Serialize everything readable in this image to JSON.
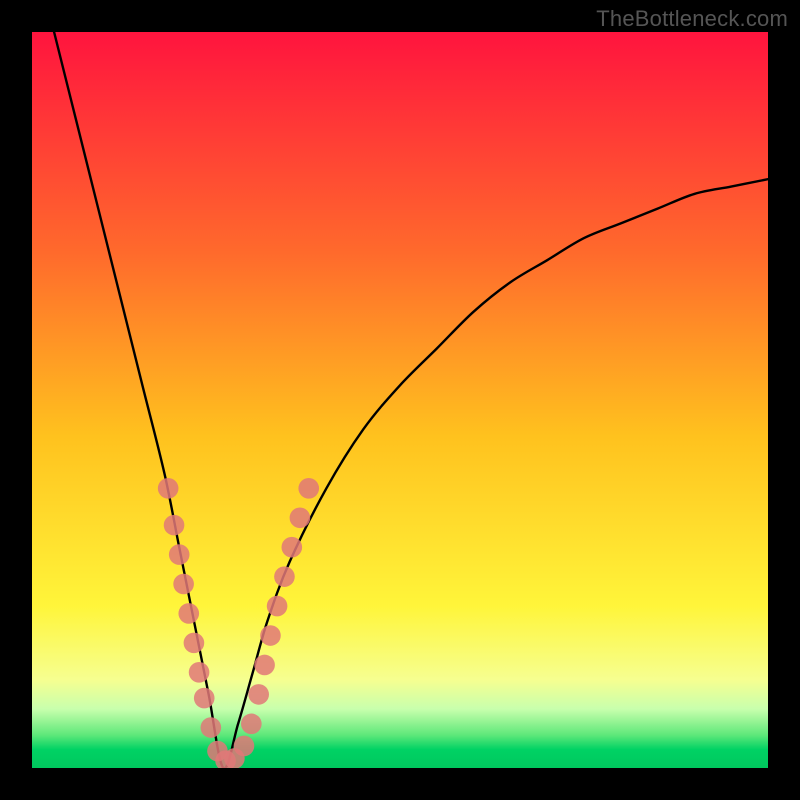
{
  "watermark": "TheBottleneck.com",
  "chart_data": {
    "type": "line",
    "title": "",
    "xlabel": "",
    "ylabel": "",
    "xlim": [
      0,
      100
    ],
    "ylim": [
      0,
      100
    ],
    "grid": false,
    "legend": false,
    "annotations": [],
    "series": [
      {
        "name": "bottleneck-curve",
        "description": "V-shaped curve; y≈100 at left, dips to ~0 near x≈26, rises to ~80 at right edge",
        "x": [
          3,
          6,
          9,
          12,
          15,
          18,
          20,
          22,
          24,
          26,
          28,
          30,
          32,
          35,
          40,
          45,
          50,
          55,
          60,
          65,
          70,
          75,
          80,
          85,
          90,
          95,
          100
        ],
        "values": [
          100,
          88,
          76,
          64,
          52,
          40,
          30,
          20,
          10,
          0,
          6,
          13,
          20,
          28,
          38,
          46,
          52,
          57,
          62,
          66,
          69,
          72,
          74,
          76,
          78,
          79,
          80
        ]
      }
    ],
    "markers": {
      "name": "highlighted-zone-dots",
      "color": "#e07878",
      "radius_pct": 1.4,
      "points": [
        {
          "x": 18.5,
          "y": 38
        },
        {
          "x": 19.3,
          "y": 33
        },
        {
          "x": 20.0,
          "y": 29
        },
        {
          "x": 20.6,
          "y": 25
        },
        {
          "x": 21.3,
          "y": 21
        },
        {
          "x": 22.0,
          "y": 17
        },
        {
          "x": 22.7,
          "y": 13
        },
        {
          "x": 23.4,
          "y": 9.5
        },
        {
          "x": 24.3,
          "y": 5.5
        },
        {
          "x": 25.2,
          "y": 2.3
        },
        {
          "x": 26.3,
          "y": 1.0
        },
        {
          "x": 27.5,
          "y": 1.3
        },
        {
          "x": 28.8,
          "y": 3.0
        },
        {
          "x": 29.8,
          "y": 6.0
        },
        {
          "x": 30.8,
          "y": 10.0
        },
        {
          "x": 31.6,
          "y": 14.0
        },
        {
          "x": 32.4,
          "y": 18.0
        },
        {
          "x": 33.3,
          "y": 22.0
        },
        {
          "x": 34.3,
          "y": 26.0
        },
        {
          "x": 35.3,
          "y": 30.0
        },
        {
          "x": 36.4,
          "y": 34.0
        },
        {
          "x": 37.6,
          "y": 38.0
        }
      ]
    },
    "background": {
      "type": "vertical-gradient",
      "stops": [
        {
          "offset": 0.0,
          "color": "#ff143e"
        },
        {
          "offset": 0.3,
          "color": "#ff6a2c"
        },
        {
          "offset": 0.55,
          "color": "#ffc21e"
        },
        {
          "offset": 0.78,
          "color": "#fff53a"
        },
        {
          "offset": 0.88,
          "color": "#f6ff90"
        },
        {
          "offset": 0.92,
          "color": "#c8ffad"
        },
        {
          "offset": 0.955,
          "color": "#5fe87a"
        },
        {
          "offset": 0.975,
          "color": "#00d264"
        },
        {
          "offset": 1.0,
          "color": "#00c85e"
        }
      ]
    }
  }
}
